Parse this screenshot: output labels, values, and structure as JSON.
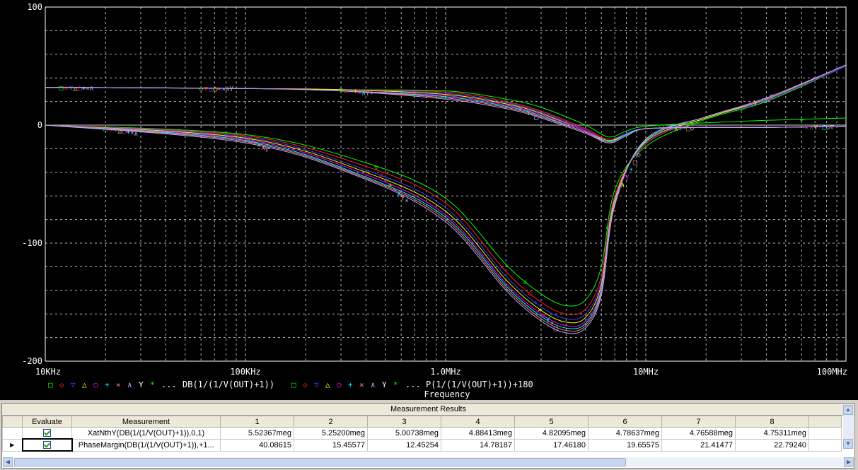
{
  "chart_data": {
    "type": "line",
    "xscale": "log",
    "xlim": [
      10000,
      100000000
    ],
    "ylim": [
      -200,
      100
    ],
    "y_ticks": [
      100,
      0,
      -100,
      -200
    ],
    "x_tick_labels": [
      "10KHz",
      "100KHz",
      "1.0MHz",
      "10MHz",
      "100MHz"
    ],
    "y_tick_labels": [
      "100",
      "0",
      "-100",
      "-200"
    ],
    "xlabel": "Frequency",
    "grid": true,
    "legend": {
      "placement": "bottom-left",
      "gain_expr": "DB(1/(1/V(OUT)+1))",
      "phase_expr": "P(1/(1/V(OUT)+1))+180",
      "ellipsis": "..."
    },
    "series_colors": [
      "#00ff00",
      "#ff2020",
      "#4040ff",
      "#ffff00",
      "#ff00ff",
      "#00ffff",
      "#ff8080",
      "#c0a0ff",
      "#ffffff"
    ],
    "gain_series": [
      {
        "values": [
          [
            10000,
            0
          ],
          [
            100000,
            -8
          ],
          [
            400000,
            -32
          ],
          [
            1000000,
            -62
          ],
          [
            2000000,
            -118
          ],
          [
            3000000,
            -143
          ],
          [
            4000000,
            -153
          ],
          [
            5000000,
            -148
          ],
          [
            6000000,
            -120
          ],
          [
            7000000,
            -55
          ],
          [
            10000000,
            -18
          ],
          [
            20000000,
            5
          ],
          [
            40000000,
            20
          ],
          [
            100000000,
            50
          ]
        ]
      },
      {
        "values": [
          [
            10000,
            0
          ],
          [
            100000,
            -9
          ],
          [
            400000,
            -35
          ],
          [
            1000000,
            -66
          ],
          [
            2000000,
            -124
          ],
          [
            3000000,
            -150
          ],
          [
            4000000,
            -160
          ],
          [
            5000000,
            -156
          ],
          [
            6000000,
            -128
          ],
          [
            7000000,
            -60
          ],
          [
            10000000,
            -16
          ],
          [
            20000000,
            6
          ],
          [
            40000000,
            21
          ],
          [
            100000000,
            50
          ]
        ]
      },
      {
        "values": [
          [
            10000,
            0
          ],
          [
            100000,
            -10
          ],
          [
            400000,
            -38
          ],
          [
            1000000,
            -70
          ],
          [
            2000000,
            -128
          ],
          [
            3000000,
            -154
          ],
          [
            4000000,
            -164
          ],
          [
            5000000,
            -160
          ],
          [
            6000000,
            -132
          ],
          [
            7000000,
            -62
          ],
          [
            10000000,
            -15
          ],
          [
            20000000,
            6
          ],
          [
            40000000,
            21
          ],
          [
            100000000,
            50
          ]
        ]
      },
      {
        "values": [
          [
            10000,
            0
          ],
          [
            100000,
            -11
          ],
          [
            400000,
            -40
          ],
          [
            1000000,
            -73
          ],
          [
            2000000,
            -131
          ],
          [
            3000000,
            -157
          ],
          [
            4000000,
            -167
          ],
          [
            5000000,
            -163
          ],
          [
            6000000,
            -135
          ],
          [
            7000000,
            -63
          ],
          [
            10000000,
            -14
          ],
          [
            20000000,
            6
          ],
          [
            40000000,
            22
          ],
          [
            100000000,
            51
          ]
        ]
      },
      {
        "values": [
          [
            10000,
            0
          ],
          [
            100000,
            -12
          ],
          [
            400000,
            -42
          ],
          [
            1000000,
            -76
          ],
          [
            2000000,
            -134
          ],
          [
            3000000,
            -160
          ],
          [
            4000000,
            -170
          ],
          [
            5000000,
            -166
          ],
          [
            6000000,
            -138
          ],
          [
            7000000,
            -65
          ],
          [
            10000000,
            -13
          ],
          [
            20000000,
            7
          ],
          [
            40000000,
            22
          ],
          [
            100000000,
            51
          ]
        ]
      },
      {
        "values": [
          [
            10000,
            0
          ],
          [
            100000,
            -13
          ],
          [
            400000,
            -44
          ],
          [
            1000000,
            -78
          ],
          [
            2000000,
            -136
          ],
          [
            3000000,
            -162
          ],
          [
            4000000,
            -172
          ],
          [
            5000000,
            -168
          ],
          [
            6000000,
            -140
          ],
          [
            7000000,
            -66
          ],
          [
            10000000,
            -13
          ],
          [
            20000000,
            7
          ],
          [
            40000000,
            22
          ],
          [
            100000000,
            51
          ]
        ]
      },
      {
        "values": [
          [
            10000,
            0
          ],
          [
            100000,
            -14
          ],
          [
            400000,
            -45
          ],
          [
            1000000,
            -80
          ],
          [
            2000000,
            -138
          ],
          [
            3000000,
            -164
          ],
          [
            4000000,
            -174
          ],
          [
            5000000,
            -170
          ],
          [
            6000000,
            -142
          ],
          [
            7000000,
            -67
          ],
          [
            10000000,
            -12
          ],
          [
            20000000,
            7
          ],
          [
            40000000,
            22
          ],
          [
            100000000,
            51
          ]
        ]
      },
      {
        "values": [
          [
            10000,
            0
          ],
          [
            100000,
            -15
          ],
          [
            400000,
            -46
          ],
          [
            1000000,
            -82
          ],
          [
            2000000,
            -140
          ],
          [
            3000000,
            -166
          ],
          [
            4000000,
            -176
          ],
          [
            5000000,
            -172
          ],
          [
            6000000,
            -144
          ],
          [
            7000000,
            -68
          ],
          [
            10000000,
            -12
          ],
          [
            20000000,
            7
          ],
          [
            40000000,
            23
          ],
          [
            100000000,
            51
          ]
        ]
      }
    ],
    "phase_series": [
      {
        "values": [
          [
            10000,
            32
          ],
          [
            100000,
            31
          ],
          [
            300000,
            30
          ],
          [
            1000000,
            29
          ],
          [
            2000000,
            22
          ],
          [
            3000000,
            15
          ],
          [
            5000000,
            0
          ],
          [
            6500000,
            -10
          ],
          [
            8000000,
            -5
          ],
          [
            10000000,
            -1
          ],
          [
            20000000,
            2
          ],
          [
            40000000,
            4
          ],
          [
            100000000,
            6
          ]
        ]
      },
      {
        "values": [
          [
            10000,
            32
          ],
          [
            100000,
            31
          ],
          [
            300000,
            30
          ],
          [
            1000000,
            28
          ],
          [
            2000000,
            20
          ],
          [
            3000000,
            12
          ],
          [
            5000000,
            -3
          ],
          [
            6500000,
            -12
          ],
          [
            8000000,
            -7
          ],
          [
            10000000,
            -3
          ],
          [
            20000000,
            -2
          ],
          [
            40000000,
            -2
          ],
          [
            100000000,
            -1
          ]
        ]
      },
      {
        "values": [
          [
            10000,
            32
          ],
          [
            100000,
            31
          ],
          [
            300000,
            30
          ],
          [
            1000000,
            27
          ],
          [
            2000000,
            19
          ],
          [
            3000000,
            11
          ],
          [
            5000000,
            -4
          ],
          [
            6500000,
            -13
          ],
          [
            8000000,
            -7
          ],
          [
            10000000,
            -3
          ],
          [
            20000000,
            -2
          ],
          [
            40000000,
            -2
          ],
          [
            100000000,
            -1
          ]
        ]
      },
      {
        "values": [
          [
            10000,
            32
          ],
          [
            100000,
            31
          ],
          [
            300000,
            30
          ],
          [
            1000000,
            26
          ],
          [
            2000000,
            18
          ],
          [
            3000000,
            10
          ],
          [
            5000000,
            -5
          ],
          [
            6500000,
            -13
          ],
          [
            8000000,
            -8
          ],
          [
            10000000,
            -3
          ],
          [
            20000000,
            -2
          ],
          [
            40000000,
            -2
          ],
          [
            100000000,
            -1
          ]
        ]
      },
      {
        "values": [
          [
            10000,
            32
          ],
          [
            100000,
            31
          ],
          [
            300000,
            29
          ],
          [
            1000000,
            25
          ],
          [
            2000000,
            17
          ],
          [
            3000000,
            9
          ],
          [
            5000000,
            -5
          ],
          [
            6500000,
            -14
          ],
          [
            8000000,
            -8
          ],
          [
            10000000,
            -3
          ],
          [
            20000000,
            -2
          ],
          [
            40000000,
            -2
          ],
          [
            100000000,
            -1
          ]
        ]
      },
      {
        "values": [
          [
            10000,
            32
          ],
          [
            100000,
            31
          ],
          [
            300000,
            29
          ],
          [
            1000000,
            24
          ],
          [
            2000000,
            16
          ],
          [
            3000000,
            8
          ],
          [
            5000000,
            -6
          ],
          [
            6500000,
            -14
          ],
          [
            8000000,
            -8
          ],
          [
            10000000,
            -3
          ],
          [
            20000000,
            -2
          ],
          [
            40000000,
            -2
          ],
          [
            100000000,
            -1
          ]
        ]
      },
      {
        "values": [
          [
            10000,
            32
          ],
          [
            100000,
            31
          ],
          [
            300000,
            29
          ],
          [
            1000000,
            23
          ],
          [
            2000000,
            15
          ],
          [
            3000000,
            7
          ],
          [
            5000000,
            -6
          ],
          [
            6500000,
            -15
          ],
          [
            8000000,
            -9
          ],
          [
            10000000,
            -3
          ],
          [
            20000000,
            -2
          ],
          [
            40000000,
            -2
          ],
          [
            100000000,
            -1
          ]
        ]
      },
      {
        "values": [
          [
            10000,
            32
          ],
          [
            100000,
            31
          ],
          [
            300000,
            29
          ],
          [
            1000000,
            22
          ],
          [
            2000000,
            14
          ],
          [
            3000000,
            6
          ],
          [
            5000000,
            -7
          ],
          [
            6500000,
            -15
          ],
          [
            8000000,
            -9
          ],
          [
            10000000,
            -3
          ],
          [
            20000000,
            -2
          ],
          [
            40000000,
            -2
          ],
          [
            100000000,
            -1
          ]
        ]
      }
    ]
  },
  "results": {
    "title": "Measurement Results",
    "headers": {
      "evaluate": "Evaluate",
      "measurement": "Measurement",
      "cols": [
        "1",
        "2",
        "3",
        "4",
        "5",
        "6",
        "7",
        "8"
      ]
    },
    "rows": [
      {
        "measurement": "XatNthY(DB(1/(1/V(OUT)+1)),0,1)",
        "evaluate": true,
        "values": [
          "5.52367meg",
          "5.25200meg",
          "5.00738meg",
          "4.88413meg",
          "4.82095meg",
          "4.78637meg",
          "4.76588meg",
          "4.75311meg"
        ]
      },
      {
        "measurement": "PhaseMargin(DB(1/(1/V(OUT)+1)),+1...",
        "evaluate": true,
        "values": [
          "40.08615",
          "15.45577",
          "12.45254",
          "14.78187",
          "17.46180",
          "19.65575",
          "21.41477",
          "22.79240"
        ]
      }
    ]
  }
}
